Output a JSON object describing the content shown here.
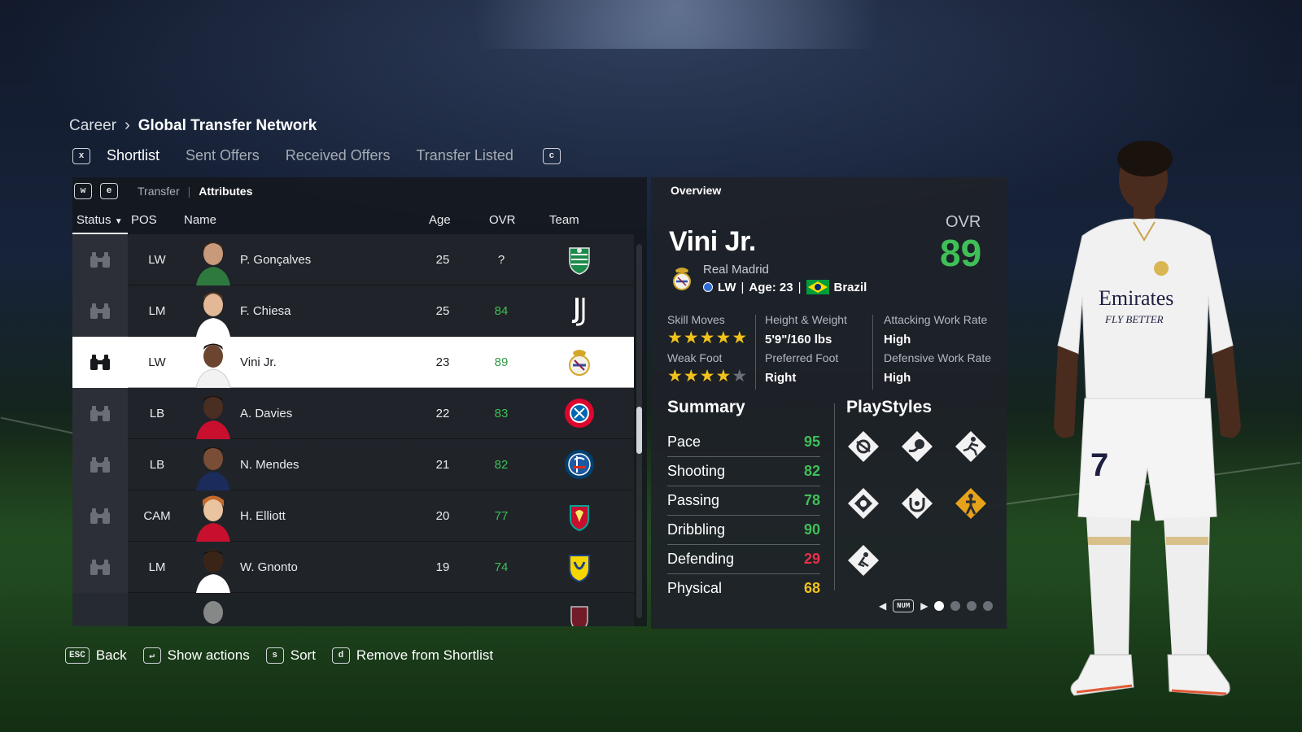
{
  "breadcrumb": {
    "root": "Career",
    "current": "Global Transfer Network"
  },
  "tabs": {
    "left_key": "x",
    "right_key": "c",
    "items": [
      {
        "label": "Shortlist",
        "active": true
      },
      {
        "label": "Sent Offers",
        "active": false
      },
      {
        "label": "Received Offers",
        "active": false
      },
      {
        "label": "Transfer Listed",
        "active": false
      }
    ]
  },
  "subtabs": {
    "left_key": "w",
    "right_key": "e",
    "items": [
      {
        "label": "Transfer",
        "active": false
      },
      {
        "label": "Attributes",
        "active": true
      }
    ]
  },
  "columns": {
    "status": "Status",
    "pos": "POS",
    "name": "Name",
    "age": "Age",
    "ovr": "OVR",
    "team": "Team"
  },
  "players": [
    {
      "pos": "LW",
      "name": "P. Gonçalves",
      "age": "25",
      "ovr": "?",
      "team": "Sporting CP",
      "crest": "sporting-crest-icon"
    },
    {
      "pos": "LM",
      "name": "F. Chiesa",
      "age": "25",
      "ovr": "84",
      "team": "Juventus",
      "crest": "juventus-crest-icon"
    },
    {
      "pos": "LW",
      "name": "Vini Jr.",
      "age": "23",
      "ovr": "89",
      "team": "Real Madrid",
      "crest": "real-madrid-crest-icon",
      "selected": true
    },
    {
      "pos": "LB",
      "name": "A. Davies",
      "age": "22",
      "ovr": "83",
      "team": "FC Bayern München",
      "crest": "bayern-crest-icon"
    },
    {
      "pos": "LB",
      "name": "N. Mendes",
      "age": "21",
      "ovr": "82",
      "team": "Paris",
      "crest": "psg-crest-icon"
    },
    {
      "pos": "CAM",
      "name": "H. Elliott",
      "age": "20",
      "ovr": "77",
      "team": "Liverpool",
      "crest": "liverpool-crest-icon"
    },
    {
      "pos": "LM",
      "name": "W. Gnonto",
      "age": "19",
      "ovr": "74",
      "team": "Leeds",
      "crest": "leeds-crest-icon"
    }
  ],
  "overview": {
    "title": "Overview",
    "name": "Vini Jr.",
    "ovr_label": "OVR",
    "ovr": "89",
    "club": "Real Madrid",
    "position": "LW",
    "age_text": "Age: 23",
    "nation": "Brazil",
    "skill_moves_label": "Skill Moves",
    "skill_moves": 5,
    "weak_foot_label": "Weak Foot",
    "weak_foot": 4,
    "height_weight_label": "Height & Weight",
    "height_weight": "5'9\"/160 lbs",
    "preferred_foot_label": "Preferred Foot",
    "preferred_foot": "Right",
    "attacking_wr_label": "Attacking Work Rate",
    "attacking_wr": "High",
    "defensive_wr_label": "Defensive Work Rate",
    "defensive_wr": "High",
    "summary_title": "Summary",
    "playstyles_title": "PlayStyles",
    "stats": [
      {
        "name": "Pace",
        "value": "95",
        "color": "#3fbf57"
      },
      {
        "name": "Shooting",
        "value": "82",
        "color": "#3fbf57"
      },
      {
        "name": "Passing",
        "value": "78",
        "color": "#3fbf57"
      },
      {
        "name": "Dribbling",
        "value": "90",
        "color": "#3fbf57"
      },
      {
        "name": "Defending",
        "value": "29",
        "color": "#e8314a"
      },
      {
        "name": "Physical",
        "value": "68",
        "color": "#f1c21b"
      }
    ],
    "pager_key": "NUM",
    "pager_pages": 4,
    "pager_active": 1
  },
  "actions": [
    {
      "key": "ESC",
      "label": "Back"
    },
    {
      "key": "↵",
      "label": "Show actions"
    },
    {
      "key": "s",
      "label": "Sort"
    },
    {
      "key": "d",
      "label": "Remove from Shortlist"
    }
  ],
  "colors": {
    "ovr_green": "#3fbf57",
    "low_red": "#e8314a",
    "mid_yellow": "#f1c21b",
    "star": "#f1c21b"
  }
}
